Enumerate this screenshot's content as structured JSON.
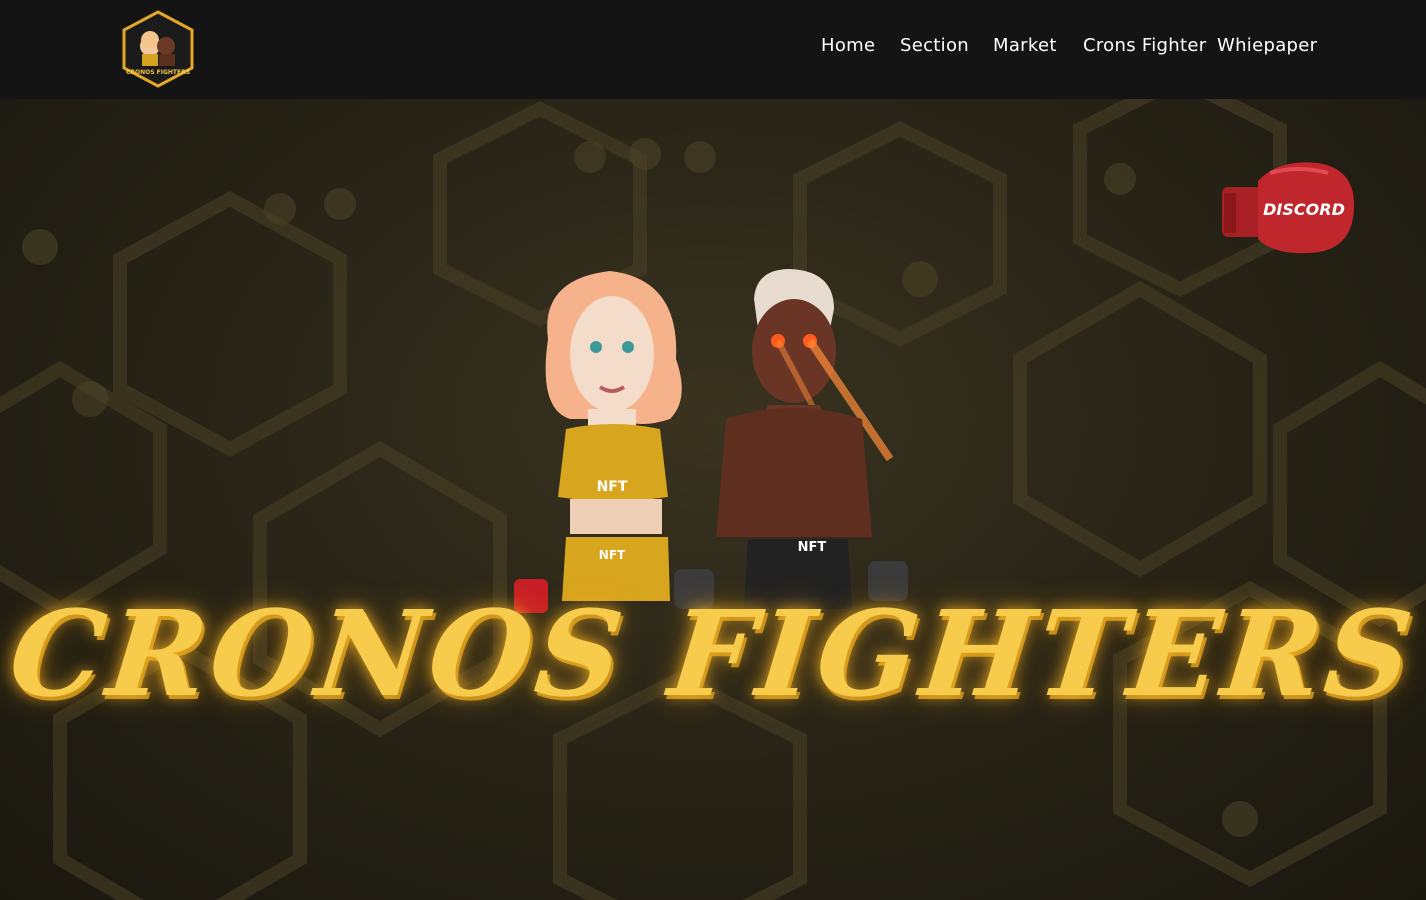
{
  "header": {
    "logo_text": "CRONOS FIGHTERS",
    "nav": [
      {
        "label": "Home"
      },
      {
        "label": "Section"
      },
      {
        "label": "Market"
      },
      {
        "label": "Crons Fighter"
      },
      {
        "label": "Whiepaper"
      }
    ]
  },
  "hero": {
    "title": "CRONOS FIGHTERS",
    "discord_label": "DISCORD",
    "fighter_shorts_text": "NFT"
  },
  "colors": {
    "nav_bg": "#141414",
    "title_gold": "#f7cc4c",
    "discord_red": "#c0272d"
  },
  "icons": [
    "logo-badge-icon",
    "boxing-glove-icon"
  ]
}
